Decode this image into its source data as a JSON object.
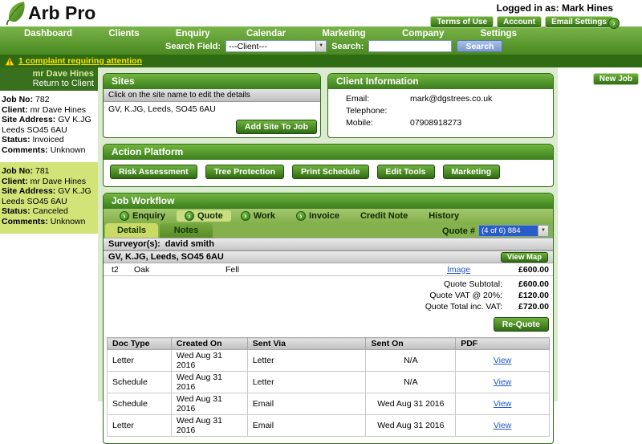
{
  "colors": {
    "brand_green": "#3a7d1c",
    "nav_green": "#49891f",
    "selected_job_highlight": "#d2e377",
    "alert_text_yellow": "#ffe400",
    "link_blue": "#2356c7",
    "quote_select_blue": "#2a5cc8"
  },
  "icons": {
    "chevron_right": "›",
    "dropdown_arrow": "▼"
  },
  "header": {
    "logo_text": "Arb Pro",
    "logged_in_label": "Logged in as:",
    "user_name": "Mark Hines",
    "terms_button": "Terms of Use",
    "account_button": "Account",
    "email_settings_button": "Email Settings"
  },
  "nav": {
    "items": [
      "Dashboard",
      "Clients",
      "Enquiry",
      "Calendar",
      "Marketing",
      "Company",
      "Settings"
    ],
    "search_field_label": "Search Field:",
    "search_field_value": "---Client---",
    "search_label": "Search:",
    "search_value": "",
    "search_button": "Search"
  },
  "alert": {
    "message": "1 complaint requiring attention"
  },
  "actions": {
    "new_job_button": "New Job"
  },
  "sidebar": {
    "client_name": "mr Dave Hines",
    "return_link": "Return to Client",
    "jobs": [
      {
        "job_no_label": "Job No:",
        "job_no": "782",
        "client_label": "Client:",
        "client": "mr Dave Hines",
        "address_label": "Site Address:",
        "address_line1": "GV K.JG",
        "address_line2": "Leeds SO45 6AU",
        "status_label": "Status:",
        "status": "Invoiced",
        "comments_label": "Comments:",
        "comments": "Unknown"
      },
      {
        "job_no_label": "Job No:",
        "job_no": "781",
        "client_label": "Client:",
        "client": "mr Dave Hines",
        "address_label": "Site Address:",
        "address_line1": "GV K.JG",
        "address_line2": "Leeds SO45 6AU",
        "status_label": "Status:",
        "status": "Canceled",
        "comments_label": "Comments:",
        "comments": "Unknown"
      }
    ]
  },
  "sites": {
    "title": "Sites",
    "instruction": "Click on the site name to edit the details",
    "site_name": "GV, K.JG, Leeds, SO45 6AU",
    "add_button": "Add Site To Job"
  },
  "client_info": {
    "title": "Client Information",
    "email_label": "Email:",
    "email": "mark@dgstrees.co.uk",
    "telephone_label": "Telephone:",
    "telephone": "",
    "mobile_label": "Mobile:",
    "mobile": "07908918273"
  },
  "action_platform": {
    "title": "Action Platform",
    "buttons": [
      "Risk Assessment",
      "Tree Protection",
      "Print Schedule",
      "Edit Tools",
      "Marketing"
    ]
  },
  "workflow": {
    "title": "Job Workflow",
    "tabs": [
      "Enquiry",
      "Quote",
      "Work",
      "Invoice",
      "Credit Note",
      "History"
    ],
    "active_tab": "Quote",
    "quote_number_label": "Quote #",
    "quote_number_value": "(4 of 6) 884",
    "details_tab": "Details",
    "notes_tab": "Notes",
    "surveyor_label": "Surveyor(s):",
    "surveyor_name": "david smith",
    "site_heading": "GV, K.JG, Leeds, SO45 6AU",
    "view_map_button": "View Map",
    "quote_item": {
      "ref": "t2",
      "tree": "Oak",
      "work": "Fell",
      "image_link": "Image",
      "price": "£600.00"
    },
    "totals": [
      {
        "label": "Quote Subtotal:",
        "value": "£600.00"
      },
      {
        "label": "Quote VAT @ 20%:",
        "value": "£120.00"
      },
      {
        "label": "Quote Total inc. VAT:",
        "value": "£720.00"
      }
    ],
    "requote_button": "Re-Quote",
    "docs": {
      "headers": [
        "Doc Type",
        "Created On",
        "Sent Via",
        "Sent On",
        "PDF"
      ],
      "rows": [
        [
          "Letter",
          "Wed Aug 31 2016",
          "Letter",
          "N/A",
          "View"
        ],
        [
          "Schedule",
          "Wed Aug 31 2016",
          "Letter",
          "N/A",
          "View"
        ],
        [
          "Schedule",
          "Wed Aug 31 2016",
          "Email",
          "Wed Aug 31 2016",
          "View"
        ],
        [
          "Letter",
          "Wed Aug 31 2016",
          "Email",
          "Wed Aug 31 2016",
          "View"
        ]
      ]
    }
  }
}
